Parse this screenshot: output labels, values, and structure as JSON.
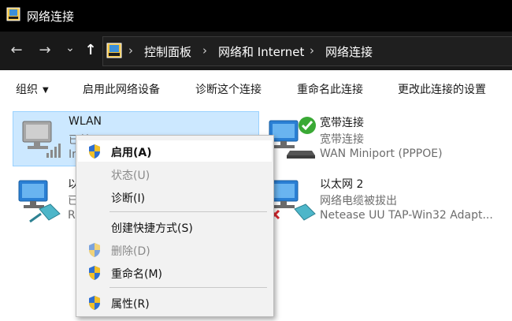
{
  "window": {
    "title": "网络连接"
  },
  "nav": {
    "back_glyph": "←",
    "forward_glyph": "→",
    "recent_glyph": "⌄",
    "up_glyph": "↑",
    "breadcrumbs": [
      "控制面板",
      "网络和 Internet",
      "网络连接"
    ],
    "separator": "›"
  },
  "toolbar": {
    "organize": "组织",
    "enable_device": "启用此网络设备",
    "diagnose": "诊断这个连接",
    "rename": "重命名此连接",
    "change_settings": "更改此连接的设置"
  },
  "connections": [
    {
      "name": "WLAN",
      "status": "已禁用",
      "device": "Intel",
      "icon": "wifi-adapter-disabled-icon",
      "selected": true
    },
    {
      "name": "宽带连接",
      "status": "宽带连接",
      "device": "WAN Miniport (PPPOE)",
      "icon": "broadband-connected-icon"
    },
    {
      "name": "以太网",
      "status": "已禁用",
      "device": "Realtek",
      "icon": "ethernet-adapter-icon"
    },
    {
      "name": "以太网 2",
      "status": "网络电缆被拔出",
      "device": "Netease UU TAP-Win32 Adapt...",
      "icon": "ethernet-unplugged-icon"
    }
  ],
  "context_menu": {
    "items": [
      {
        "label": "启用(A)",
        "bold": true,
        "shield": true,
        "disabled": false,
        "highlighted": true
      },
      {
        "label": "状态(U)",
        "bold": false,
        "shield": false,
        "disabled": true
      },
      {
        "label": "诊断(I)",
        "bold": false,
        "shield": false,
        "disabled": false
      },
      {
        "label": "创建快捷方式(S)",
        "bold": false,
        "shield": false,
        "disabled": false
      },
      {
        "label": "删除(D)",
        "bold": false,
        "shield": true,
        "disabled": true
      },
      {
        "label": "重命名(M)",
        "bold": false,
        "shield": true,
        "disabled": false
      },
      {
        "label": "属性(R)",
        "bold": false,
        "shield": true,
        "disabled": false
      }
    ]
  },
  "colors": {
    "titlebar_bg": "#000000",
    "navbar_bg": "#191919",
    "selection_bg": "#cce8ff",
    "menu_bg": "#f2f2f2",
    "status_ok": "#3aa935",
    "status_error": "#d9262e",
    "shield_blue": "#2f6fd0",
    "shield_yellow": "#f2c028"
  }
}
